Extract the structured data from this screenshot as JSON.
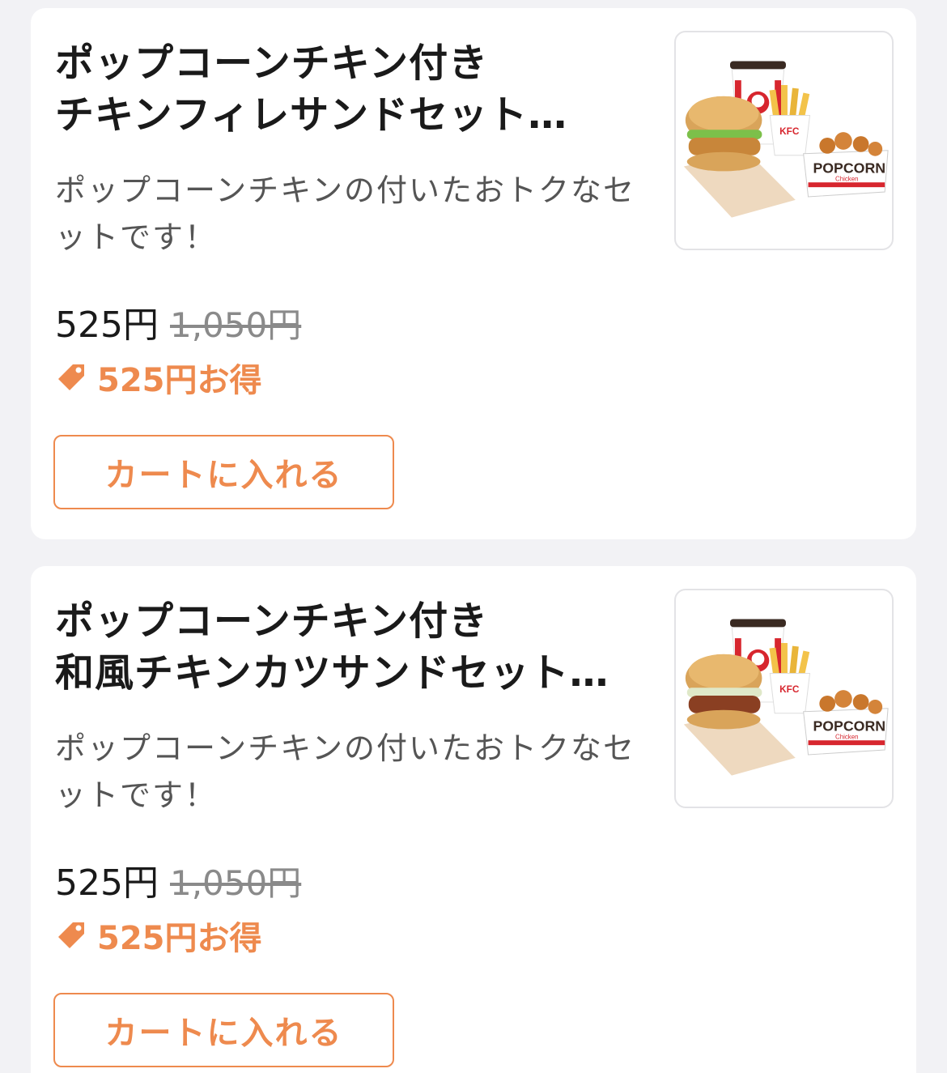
{
  "items": [
    {
      "title_line1": "ポップコーンチキン付き",
      "title_line2": "チキンフィレサンドセット…",
      "description": "ポップコーンチキンの付いたおトクなセットです！",
      "price": "525円",
      "original_price": "1,050円",
      "saving": "525円お得",
      "cart_label": "カートに入れる",
      "image_icon": "kfc-set-photo",
      "image_cup_label": "",
      "image_box_label": "KFC",
      "image_popcorn_label": "POPCORN",
      "image_popcorn_sub": "Chicken"
    },
    {
      "title_line1": "ポップコーンチキン付き",
      "title_line2": "和風チキンカツサンドセット…",
      "description": "ポップコーンチキンの付いたおトクなセットです！",
      "price": "525円",
      "original_price": "1,050円",
      "saving": "525円お得",
      "cart_label": "カートに入れる",
      "image_icon": "kfc-set-photo",
      "image_cup_label": "",
      "image_box_label": "KFC",
      "image_popcorn_label": "POPCORN",
      "image_popcorn_sub": "Chicken"
    }
  ],
  "colors": {
    "accent": "#ee8a4e",
    "background": "#f2f2f5",
    "card": "#ffffff",
    "text": "#1a1a1a",
    "muted": "#8a8a8a"
  }
}
